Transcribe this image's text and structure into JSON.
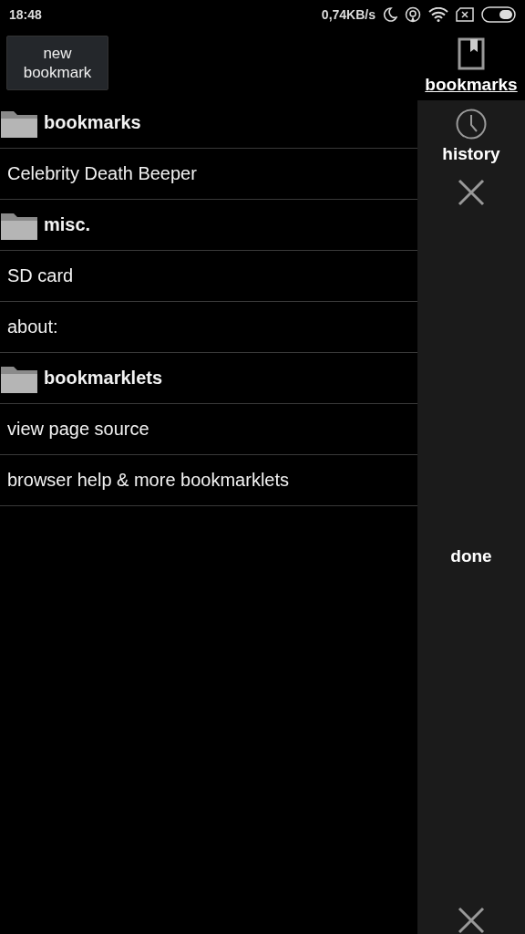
{
  "status_bar": {
    "time": "18:48",
    "speed": "0,74KB/s"
  },
  "new_bookmark_button": "new\nbookmark",
  "items": [
    {
      "kind": "folder",
      "label": "bookmarks"
    },
    {
      "kind": "link",
      "label": "Celebrity Death Beeper"
    },
    {
      "kind": "folder",
      "label": "misc."
    },
    {
      "kind": "link",
      "label": "SD card"
    },
    {
      "kind": "link",
      "label": "about:"
    },
    {
      "kind": "folder",
      "label": "bookmarklets"
    },
    {
      "kind": "link",
      "label": "view page source"
    },
    {
      "kind": "link",
      "label": "browser help & more bookmarklets"
    }
  ],
  "tabs": [
    {
      "kind": "bookmark",
      "label": "bookmarks",
      "selected": true
    },
    {
      "kind": "clock",
      "label": "history",
      "selected": false
    }
  ],
  "done_button": "done"
}
